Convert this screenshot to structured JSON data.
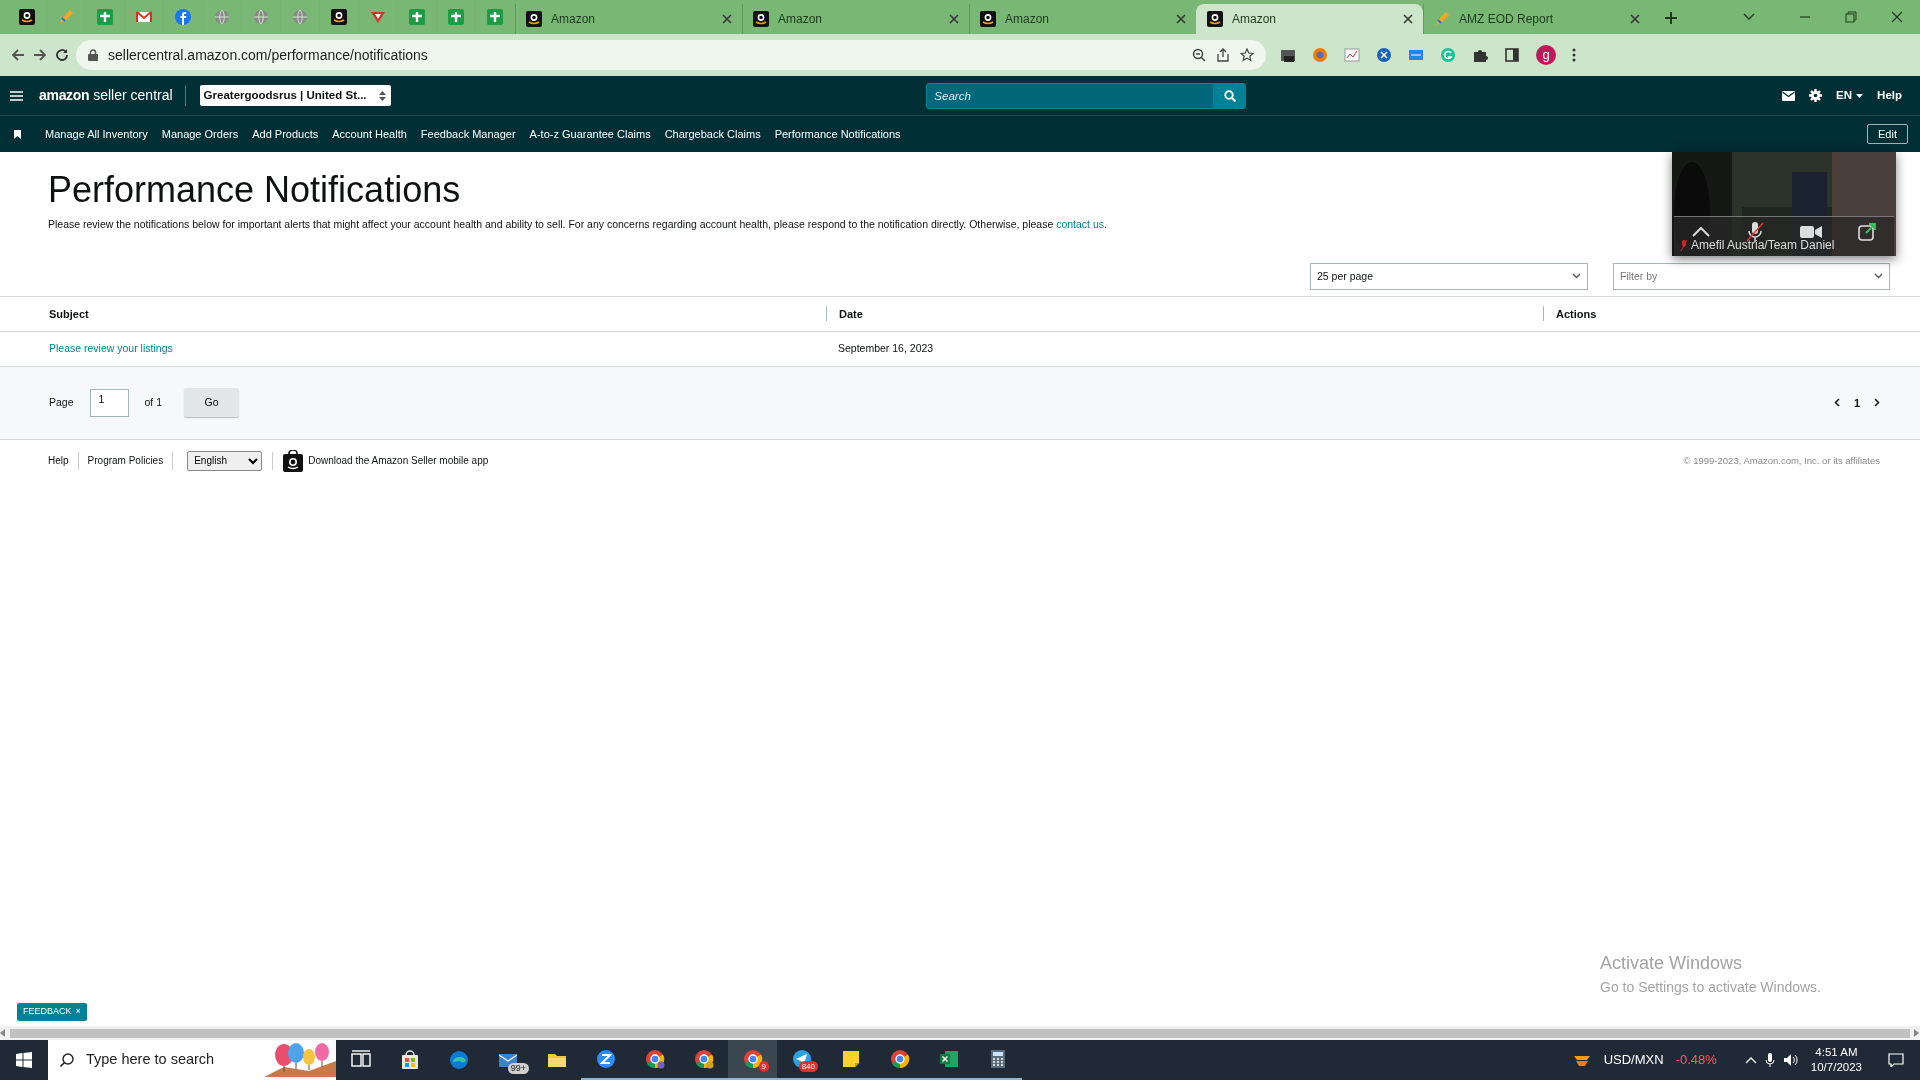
{
  "browser": {
    "tabs": [
      {
        "title": "Amazon",
        "selected": false
      },
      {
        "title": "Amazon",
        "selected": false
      },
      {
        "title": "Amazon",
        "selected": false
      },
      {
        "title": "Amazon",
        "selected": true
      },
      {
        "title": "AMZ EOD Report",
        "selected": false
      }
    ],
    "address": "sellercentral.amazon.com/performance/notifications",
    "profile": "g"
  },
  "header": {
    "logo": {
      "brand": "amazon",
      "product": "seller central"
    },
    "store": "Greatergoodsrus | United St...",
    "search": {
      "placeholder": "Search"
    },
    "language": "EN",
    "help": "Help"
  },
  "nav": {
    "items": [
      "Manage All Inventory",
      "Manage Orders",
      "Add Products",
      "Account Health",
      "Feedback Manager",
      "A-to-z Guarantee Claims",
      "Chargeback Claims",
      "Performance Notifications"
    ],
    "edit": "Edit"
  },
  "page": {
    "title": "Performance Notifications",
    "intro": "Please review the notifications below for important alerts that might affect your account health and ability to sell. For any concerns regarding account health, please respond to the notification directly. Otherwise, please",
    "intro_link": "contact us",
    "intro_end": "."
  },
  "controls": {
    "per_page": "25 per page",
    "filter": {
      "placeholder": "Filter by"
    }
  },
  "table": {
    "columns": [
      "Subject",
      "Date",
      "Actions"
    ],
    "rows": [
      {
        "subject": "Please review your listings",
        "date": "September 16, 2023"
      }
    ]
  },
  "pagination": {
    "label": "Page",
    "page": "1",
    "of": "of 1",
    "go": "Go",
    "current": "1"
  },
  "footer": {
    "links": [
      "Help",
      "Program Policies"
    ],
    "language": "English",
    "app": "Download the Amazon Seller mobile app",
    "copyright": "© 1999-2023, Amazon.com, Inc. or its affiliates"
  },
  "feedback": {
    "label": "FEEDBACK",
    "close": "×"
  },
  "video": {
    "participant": "Amefil Austria/Team Daniel",
    "muted": true
  },
  "watermark": {
    "title": "Activate Windows",
    "text": "Go to Settings to activate Windows."
  },
  "taskbar": {
    "search": {
      "placeholder": "Type here to search"
    },
    "apps": [
      {
        "running": false,
        "selected": false
      },
      {
        "running": false,
        "selected": false
      },
      {
        "running": false,
        "selected": false
      },
      {
        "running": false,
        "selected": false,
        "badge": "99+"
      },
      {
        "running": false,
        "selected": false
      },
      {
        "running": true,
        "selected": false
      },
      {
        "running": true,
        "selected": false
      },
      {
        "running": true,
        "selected": false
      },
      {
        "running": true,
        "selected": true,
        "badge": "9"
      },
      {
        "running": true,
        "selected": false,
        "badge": "840"
      },
      {
        "running": true,
        "selected": false
      },
      {
        "running": true,
        "selected": false
      },
      {
        "running": true,
        "selected": false
      },
      {
        "running": true,
        "selected": false
      }
    ],
    "ticker": {
      "pair": "USD/MXN",
      "change": "-0.48%"
    },
    "time": "4:51 AM",
    "date": "10/7/2023"
  }
}
